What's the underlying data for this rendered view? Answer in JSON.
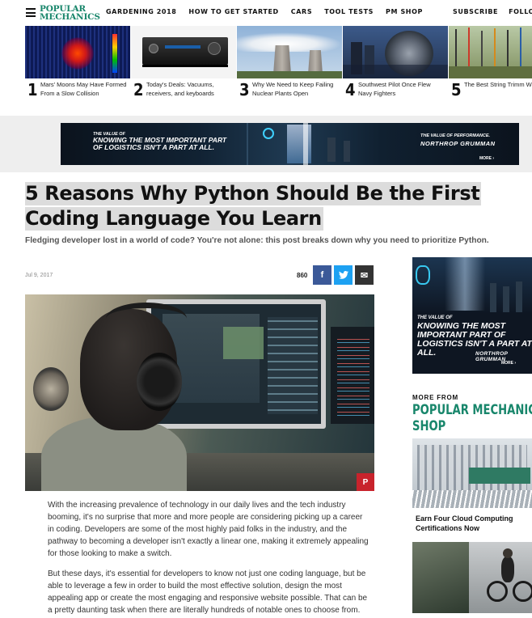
{
  "nav": {
    "logo_line1": "POPULAR",
    "logo_line2": "MECHANICS",
    "links": [
      "GARDENING 2018",
      "HOW TO GET STARTED",
      "CARS",
      "TOOL TESTS",
      "PM SHOP"
    ],
    "subscribe": "SUBSCRIBE",
    "follow": "FOLLO"
  },
  "trending": [
    {
      "num": "1",
      "text": "Mars' Moons May Have Formed From a Slow Collision"
    },
    {
      "num": "2",
      "text": "Today's Deals: Vacuums, receivers, and keyboards"
    },
    {
      "num": "3",
      "text": "Why We Need to Keep Failing Nuclear Plants Open"
    },
    {
      "num": "4",
      "text": "Southwest Pilot Once Flew Navy Fighters"
    },
    {
      "num": "5",
      "text": "The Best String Trimm Weed Wacker Reviews"
    }
  ],
  "ad_banner": {
    "left_small": "THE VALUE OF",
    "left_big": "KNOWING THE MOST IMPORTANT PART OF LOGISTICS ISN'T A PART AT ALL.",
    "right_small": "THE VALUE OF PERFORMANCE.",
    "brand": "NORTHROP GRUMMAN",
    "more": "MORE ›"
  },
  "article": {
    "title_line1": "5 Reasons Why Python Should Be the First",
    "title_line2": "Coding Language You Learn",
    "dek": "Fledging developer lost in a world of code? You're not alone: this post breaks down why you need to prioritize Python.",
    "date": "Jul 9, 2017",
    "share_count": "860",
    "share": {
      "facebook": "f",
      "twitter": "t",
      "email": "✉"
    },
    "pin_label": "P",
    "paragraphs": [
      "With the increasing prevalence of technology in our daily lives and the tech industry booming, it's no surprise that more and more people are considering picking up a career in coding. Developers are some of the most highly paid folks in the industry, and the pathway to becoming a developer isn't exactly a linear one, making it extremely appealing for those looking to make a switch.",
      "But these days, it's essential for developers to know not just one coding language, but be able to leverage a few in order to build the most effective solution, design the most appealing app or create the most engaging and responsive website possible. That can be a pretty daunting task when there are literally hundreds of notable ones to choose from."
    ]
  },
  "sidebar": {
    "ad_small": "THE VALUE OF",
    "ad_big": "KNOWING THE MOST IMPORTANT PART OF LOGISTICS ISN'T A PART AT ALL.",
    "ad_brand": "NORTHROP GRUMMAN",
    "ad_more": "MORE ›",
    "more_from": "MORE FROM",
    "shop_title_line1": "POPULAR MECHANICS",
    "shop_title_line2": "SHOP",
    "item1": "Earn Four Cloud Computing Certifications Now"
  },
  "colors": {
    "brand_green": "#18866b",
    "facebook": "#3b5998",
    "twitter": "#1da1f2",
    "email": "#333333",
    "pinterest": "#c8232c"
  }
}
